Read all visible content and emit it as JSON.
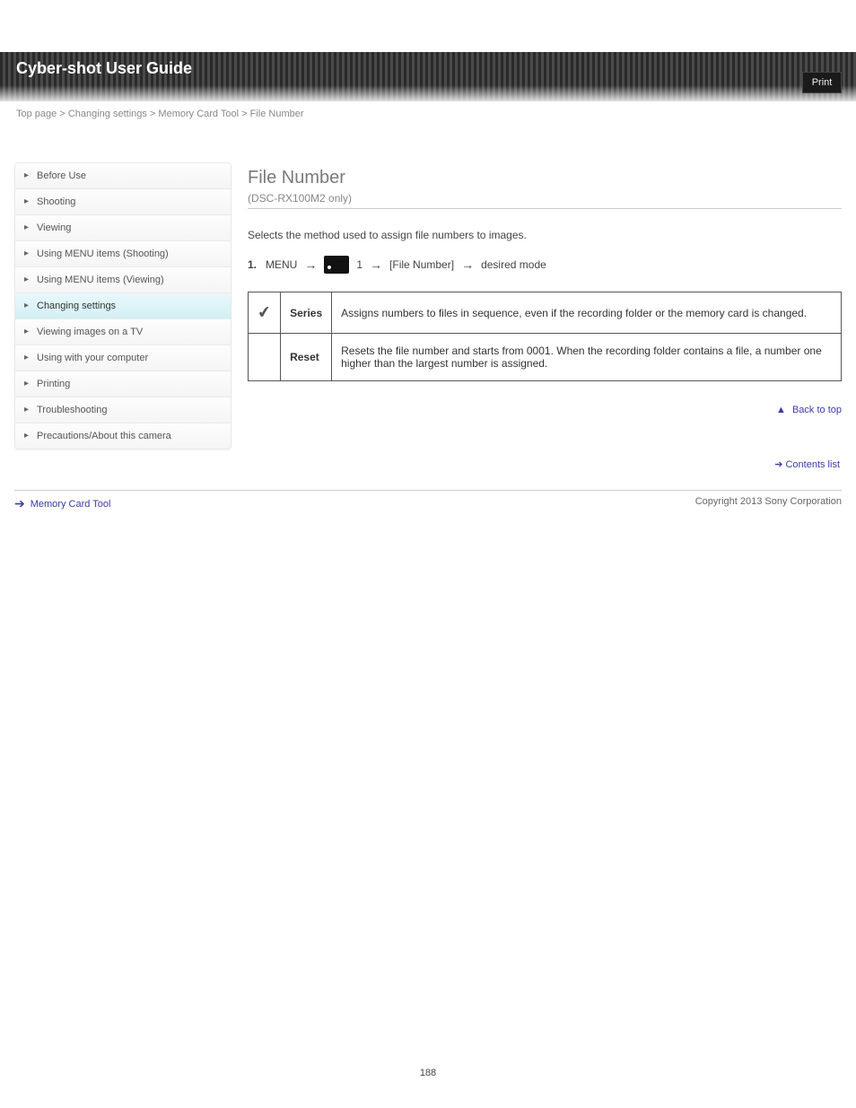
{
  "topbar": {
    "title": "Cyber-shot User Guide",
    "print_label": "Print"
  },
  "breadcrumb": {
    "parts": [
      "Top page",
      "Changing settings",
      "Memory Card Tool",
      "File Number"
    ]
  },
  "sidebar": {
    "items": [
      {
        "label": "Before Use"
      },
      {
        "label": "Shooting"
      },
      {
        "label": "Viewing"
      },
      {
        "label": "Using MENU items (Shooting)"
      },
      {
        "label": "Using MENU items (Viewing)"
      },
      {
        "label": "Changing settings"
      },
      {
        "label": "Viewing images on a TV"
      },
      {
        "label": "Using with your computer"
      },
      {
        "label": "Printing"
      },
      {
        "label": "Troubleshooting"
      },
      {
        "label": "Precautions/About this camera"
      }
    ],
    "active_index": 5,
    "contents_link": "Contents list"
  },
  "main": {
    "title": "File Number",
    "subtitle": "(DSC-RX100M2 only)",
    "description": "Selects the method used to assign file numbers to images.",
    "steps": {
      "step1_prefix": "1.",
      "step1_label": "MENU",
      "card_label": "1",
      "file_no": "[File Number]",
      "desired": "desired mode"
    },
    "table": {
      "rows": [
        {
          "checked": true,
          "opt": "Series",
          "desc": "Assigns numbers to files in sequence, even if the recording folder or the memory card is changed."
        },
        {
          "checked": false,
          "opt": "Reset",
          "desc": "Resets the file number and starts from 0001. When the recording folder contains a file, a number one higher than the largest number is assigned."
        }
      ]
    },
    "back_to_top": "Back to top"
  },
  "footer": {
    "nav_label": "Memory Card Tool",
    "copyright": "Copyright 2013 Sony Corporation"
  },
  "page_number": "188"
}
